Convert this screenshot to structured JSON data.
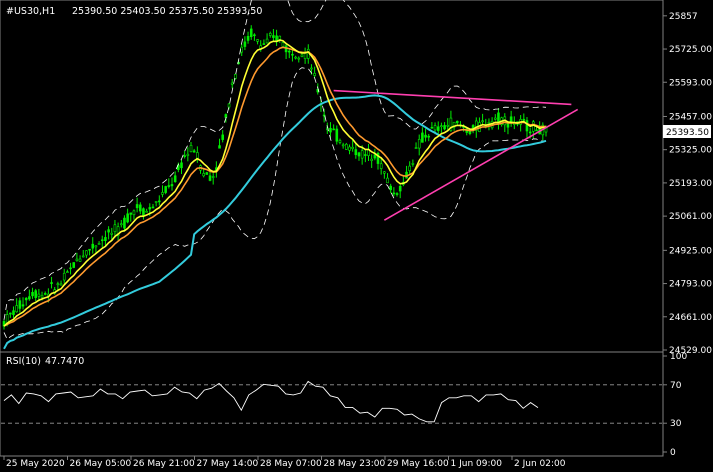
{
  "header": {
    "symbol": "#US30,H1",
    "ohlc": "25390.50 25403.50 25375.50 25393.50"
  },
  "price_tag": "25393.50",
  "indicator": {
    "name": "RSI(10)",
    "value": "47.7470"
  },
  "chart_data": [
    {
      "type": "candlestick",
      "ylim": [
        24529,
        25900
      ],
      "y_ticks": [
        25857,
        25725,
        25593,
        25457,
        25325,
        25193,
        25061,
        24925,
        24793,
        24661,
        24529
      ],
      "y_tick_labels": [
        "25857",
        "25725.00",
        "25593.00",
        "25457.00",
        "25325.00",
        "25193.00",
        "25061.00",
        "24925.00",
        "24793.00",
        "24661.00",
        "24529.00"
      ],
      "x_labels": [
        "25 May 2020",
        "26 May 05:00",
        "26 May 21:00",
        "27 May 14:00",
        "28 May 07:00",
        "28 May 23:00",
        "29 May 16:00",
        "1 Jun 09:00",
        "2 Jun 02:00"
      ],
      "price_profile": [
        [
          0,
          24640
        ],
        [
          3,
          24680
        ],
        [
          6,
          24720
        ],
        [
          9,
          24760
        ],
        [
          12,
          24750
        ],
        [
          15,
          24770
        ],
        [
          18,
          24790
        ],
        [
          21,
          24850
        ],
        [
          24,
          24900
        ],
        [
          27,
          24930
        ],
        [
          30,
          24960
        ],
        [
          33,
          24990
        ],
        [
          36,
          25000
        ],
        [
          39,
          25060
        ],
        [
          42,
          25100
        ],
        [
          45,
          25080
        ],
        [
          48,
          25110
        ],
        [
          51,
          25160
        ],
        [
          54,
          25210
        ],
        [
          57,
          25300
        ],
        [
          60,
          25330
        ],
        [
          63,
          25230
        ],
        [
          66,
          25220
        ],
        [
          69,
          25380
        ],
        [
          72,
          25590
        ],
        [
          75,
          25720
        ],
        [
          78,
          25790
        ],
        [
          81,
          25740
        ],
        [
          84,
          25760
        ],
        [
          87,
          25770
        ],
        [
          90,
          25710
        ],
        [
          93,
          25720
        ],
        [
          96,
          25700
        ],
        [
          99,
          25560
        ],
        [
          102,
          25420
        ],
        [
          105,
          25380
        ],
        [
          108,
          25340
        ],
        [
          111,
          25320
        ],
        [
          114,
          25300
        ],
        [
          117,
          25320
        ],
        [
          120,
          25230
        ],
        [
          123,
          25150
        ],
        [
          126,
          25190
        ],
        [
          129,
          25290
        ],
        [
          132,
          25370
        ],
        [
          135,
          25400
        ],
        [
          138,
          25410
        ],
        [
          141,
          25430
        ],
        [
          144,
          25420
        ],
        [
          147,
          25400
        ],
        [
          150,
          25420
        ],
        [
          153,
          25440
        ],
        [
          156,
          25450
        ],
        [
          159,
          25440
        ],
        [
          162,
          25430
        ],
        [
          165,
          25420
        ],
        [
          168,
          25410
        ],
        [
          171,
          25393
        ]
      ],
      "trendlines": [
        {
          "color": "#ff3fb0",
          "from": [
            104,
            25560
          ],
          "to": [
            179,
            25505
          ]
        },
        {
          "color": "#ff3fb0",
          "from": [
            120,
            25045
          ],
          "to": [
            181,
            25485
          ]
        }
      ],
      "series_colors": {
        "candles": "#00ee00",
        "ema_fast": "#ff9a2e",
        "ema_mid": "#ffff33",
        "sma_slow": "#33ccdd",
        "bands": "#ffffff"
      }
    },
    {
      "type": "line",
      "ylim": [
        0,
        100
      ],
      "levels": [
        70,
        30
      ],
      "y_tick_labels": [
        "100",
        "70",
        "30",
        "0"
      ],
      "y_ticks": [
        100,
        70,
        30,
        0
      ],
      "line_color": "#ffffff",
      "values": [
        55,
        58,
        52,
        60,
        62,
        57,
        54,
        59,
        63,
        61,
        58,
        56,
        60,
        64,
        62,
        59,
        57,
        61,
        65,
        63,
        60,
        58,
        62,
        66,
        64,
        60,
        57,
        63,
        68,
        70,
        65,
        55,
        45,
        58,
        66,
        69,
        71,
        67,
        62,
        58,
        63,
        72,
        70,
        66,
        60,
        55,
        48,
        45,
        42,
        40,
        38,
        44,
        47,
        43,
        40,
        38,
        36,
        30,
        33,
        50,
        58,
        55,
        60,
        57,
        54,
        58,
        61,
        59,
        56,
        52,
        47,
        50,
        47.747
      ]
    }
  ]
}
